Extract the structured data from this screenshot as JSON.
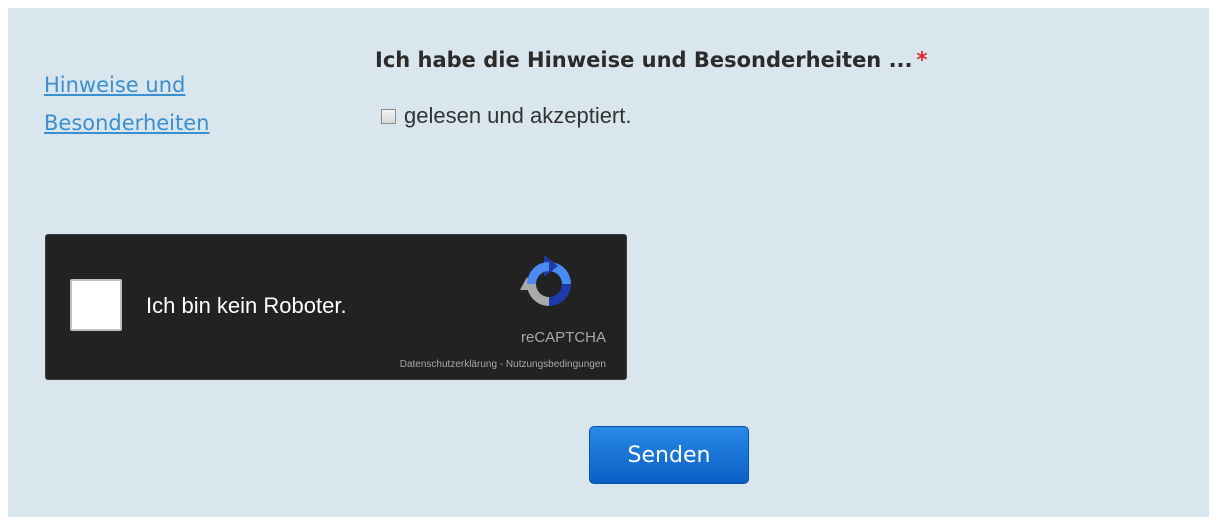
{
  "form": {
    "side_link": "Hinweise und Besonderheiten",
    "question": "Ich habe die Hinweise und Besonderheiten ...",
    "required_marker": "*",
    "accept_label": "gelesen und akzeptiert.",
    "submit_label": "Senden"
  },
  "captcha": {
    "label": "Ich bin kein Roboter.",
    "brand": "reCAPTCHA",
    "privacy_link": "Datenschutzerklärung",
    "separator": " - ",
    "terms_link": "Nutzungsbedingungen"
  },
  "colors": {
    "panel_background": "#d9e6ed",
    "link": "#3a8fcf",
    "required": "#e0262b",
    "captcha_background": "#222222",
    "button": "#0a5fc4"
  },
  "icons": {
    "captcha_logo": "recaptcha-logo-icon"
  }
}
